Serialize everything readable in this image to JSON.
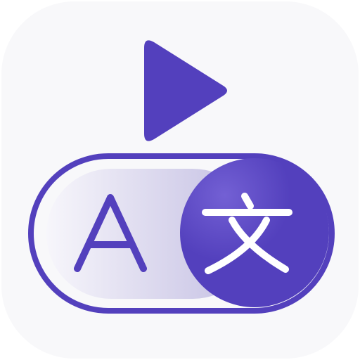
{
  "app_icon": {
    "background": "#f8f8fa",
    "accent": "#5340bd",
    "accent_light": "#7360d4",
    "toggle_fill_start": "#f7f6fb",
    "toggle_fill_end": "#c2bde2",
    "glyph_color": "#ffffff",
    "icons": [
      "play-icon",
      "language-toggle-icon",
      "letter-a-glyph",
      "chinese-character-glyph"
    ],
    "toggle": {
      "state": "on",
      "left_glyph": "A",
      "right_glyph": "文"
    }
  }
}
